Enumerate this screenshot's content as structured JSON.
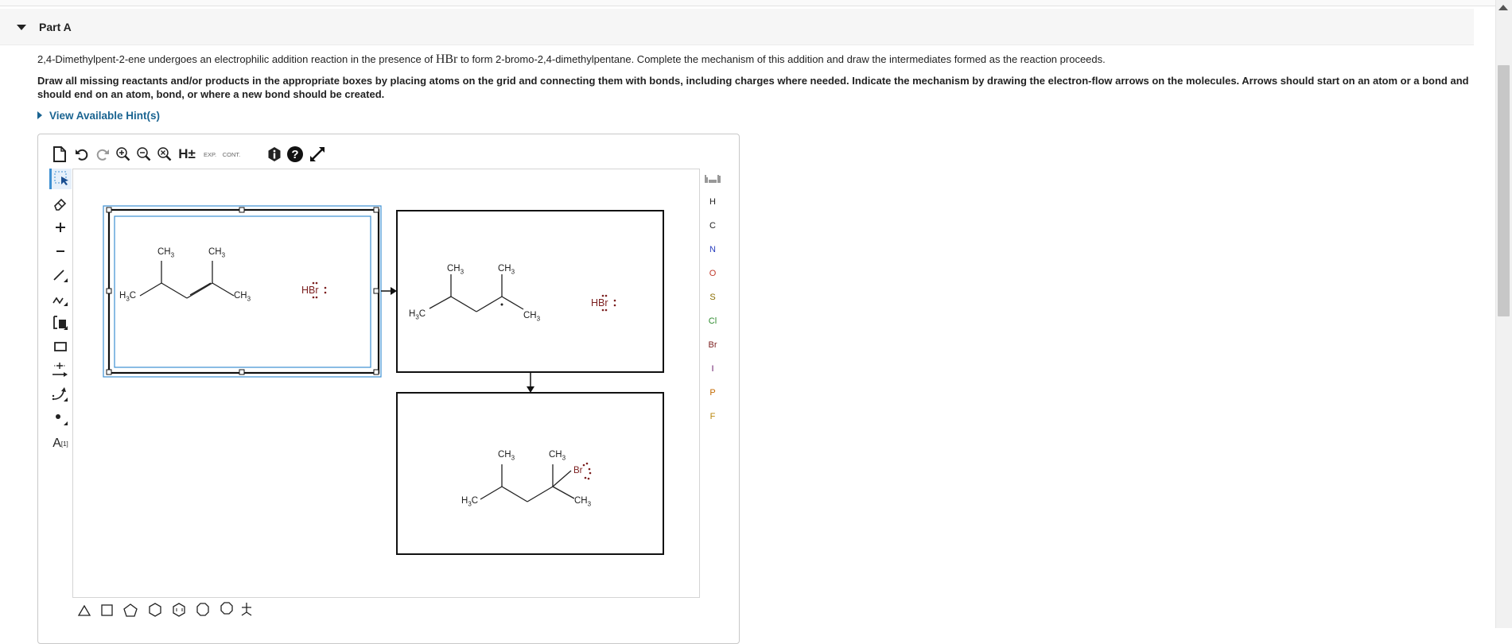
{
  "part": {
    "title": "Part A"
  },
  "question": {
    "before": "2,4-Dimethylpent-2-ene undergoes an electrophilic addition reaction in the presence of ",
    "reagent": "HBr",
    "after": " to form 2-bromo-2,4-dimethylpentane. Complete the mechanism of this addition and draw the intermediates formed as the reaction proceeds."
  },
  "instructions": "Draw all missing reactants and/or products in the appropriate boxes by placing atoms on the grid and connecting them with bonds, including charges where needed. Indicate the mechanism by drawing the electron-flow arrows on the molecules. Arrows should start on an atom or a bond and should end on an atom, bond, or where a new bond should be created.",
  "hint_link": "View Available Hint(s)",
  "toolbar": {
    "h_label": "H±",
    "exp_label": "EXP.",
    "cont_label": "CONT."
  },
  "left_tools": {
    "text_tool": "A",
    "text_tool_sup": "[1]"
  },
  "atoms": [
    "H",
    "C",
    "N",
    "O",
    "S",
    "Cl",
    "Br",
    "I",
    "P",
    "F"
  ],
  "atom_colors": {
    "H": "#444444",
    "C": "#444444",
    "N": "#2a3fbf",
    "O": "#c0392b",
    "S": "#8a6d00",
    "Cl": "#2e8b2e",
    "Br": "#7b1e1e",
    "I": "#6a1b6a",
    "P": "#c46a00",
    "F": "#b8860b"
  },
  "molecules": {
    "box1": {
      "ch3_a": "CH3",
      "ch3_b": "CH3",
      "h3c": "H3C",
      "ch3_c": "CH3",
      "hbr": "HBr"
    },
    "box2": {
      "ch3_a": "CH3",
      "ch3_b": "CH3",
      "h3c": "H3C",
      "ch3_c": "CH3",
      "hbr": "HBr"
    },
    "box3": {
      "ch3_a": "CH3",
      "ch3_b": "CH3",
      "h3c": "H3C",
      "ch3_c": "CH3",
      "br": "Br"
    }
  },
  "colors": {
    "accent": "#1a6491",
    "selection": "#3d8fd1",
    "bromine": "#7b1e1e"
  }
}
